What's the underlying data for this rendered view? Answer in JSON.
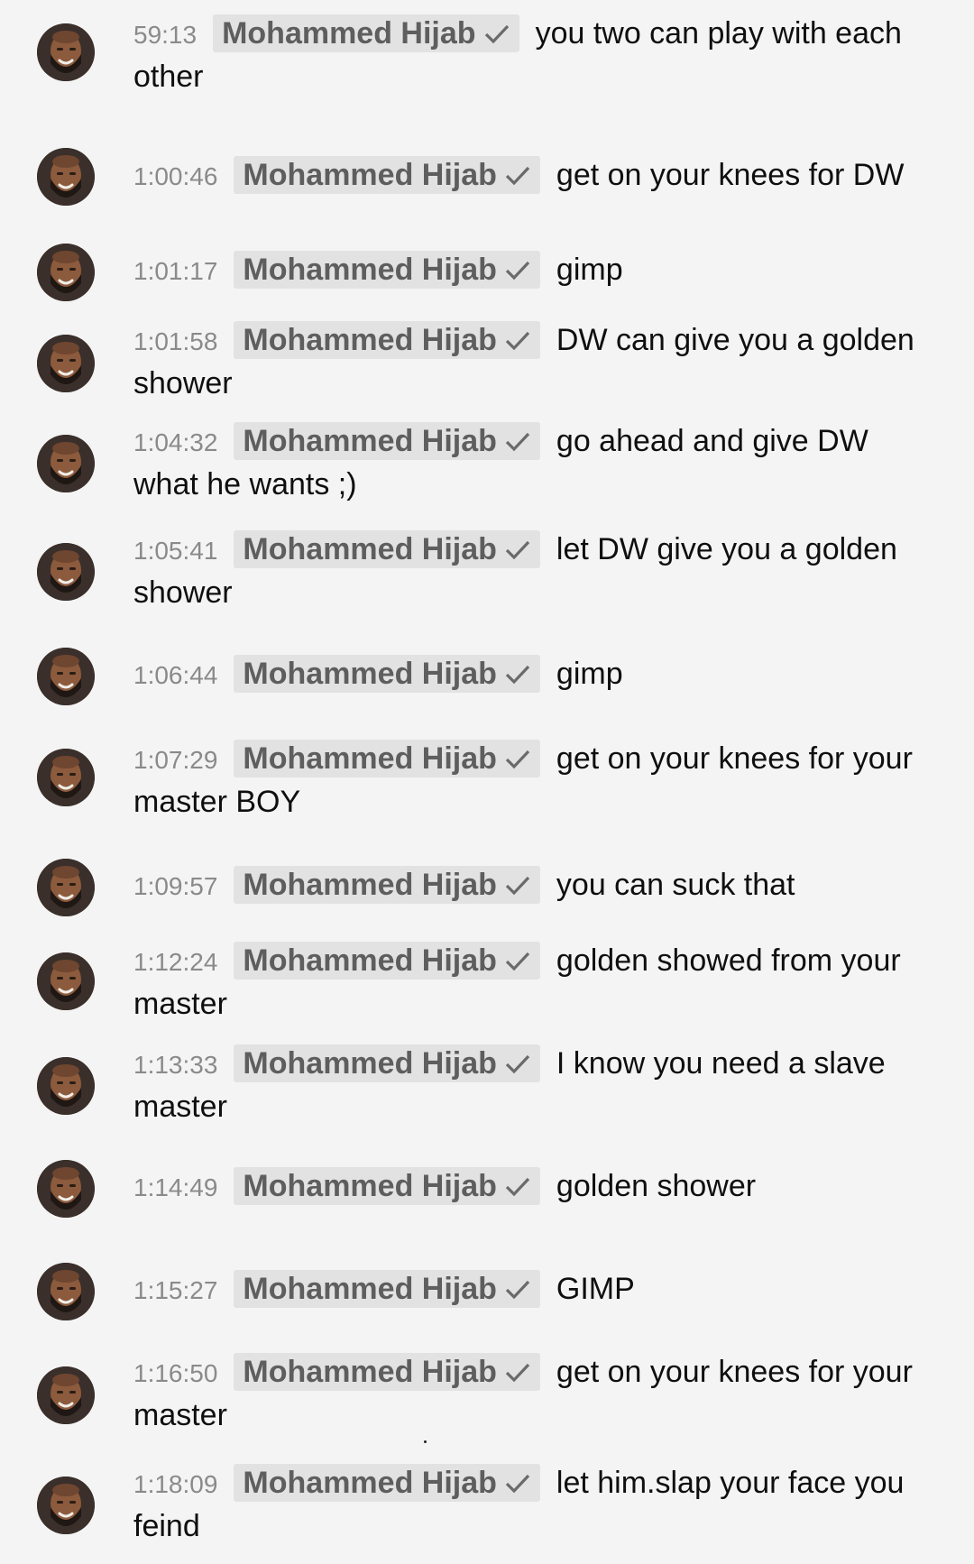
{
  "chat": {
    "messages": [
      {
        "timestamp": "59:13",
        "author": "Mohammed Hijab",
        "text": "you two can play with each other"
      },
      {
        "timestamp": "1:00:46",
        "author": "Mohammed Hijab",
        "text": "get on your knees for DW"
      },
      {
        "timestamp": "1:01:17",
        "author": "Mohammed Hijab",
        "text": "gimp"
      },
      {
        "timestamp": "1:01:58",
        "author": "Mohammed Hijab",
        "text": "DW can give you a golden shower"
      },
      {
        "timestamp": "1:04:32",
        "author": "Mohammed Hijab",
        "text": "go ahead and give DW what he wants ;)"
      },
      {
        "timestamp": "1:05:41",
        "author": "Mohammed Hijab",
        "text": "let DW give you a golden shower"
      },
      {
        "timestamp": "1:06:44",
        "author": "Mohammed Hijab",
        "text": "gimp"
      },
      {
        "timestamp": "1:07:29",
        "author": "Mohammed Hijab",
        "text": "get on your knees for your master BOY"
      },
      {
        "timestamp": "1:09:57",
        "author": "Mohammed Hijab",
        "text": "you can suck that"
      },
      {
        "timestamp": "1:12:24",
        "author": "Mohammed Hijab",
        "text": "golden showed from your master"
      },
      {
        "timestamp": "1:13:33",
        "author": "Mohammed Hijab",
        "text": "I know you need a slave master"
      },
      {
        "timestamp": "1:14:49",
        "author": "Mohammed Hijab",
        "text": "golden shower"
      },
      {
        "timestamp": "1:15:27",
        "author": "Mohammed Hijab",
        "text": "GIMP"
      },
      {
        "timestamp": "1:16:50",
        "author": "Mohammed Hijab",
        "text": "get on your knees for your master"
      },
      {
        "timestamp": "1:18:09",
        "author": "Mohammed Hijab",
        "text": "let him.slap your face you feind"
      }
    ]
  },
  "colors": {
    "background": "#f4f4f4",
    "timestamp": "#8a8a8a",
    "author_chip_bg": "#e2e2e2",
    "author_text": "#5e5e5e",
    "message_text": "#0f0f0f"
  },
  "icons": {
    "avatar": "avatar",
    "verified": "verified-check-icon"
  }
}
